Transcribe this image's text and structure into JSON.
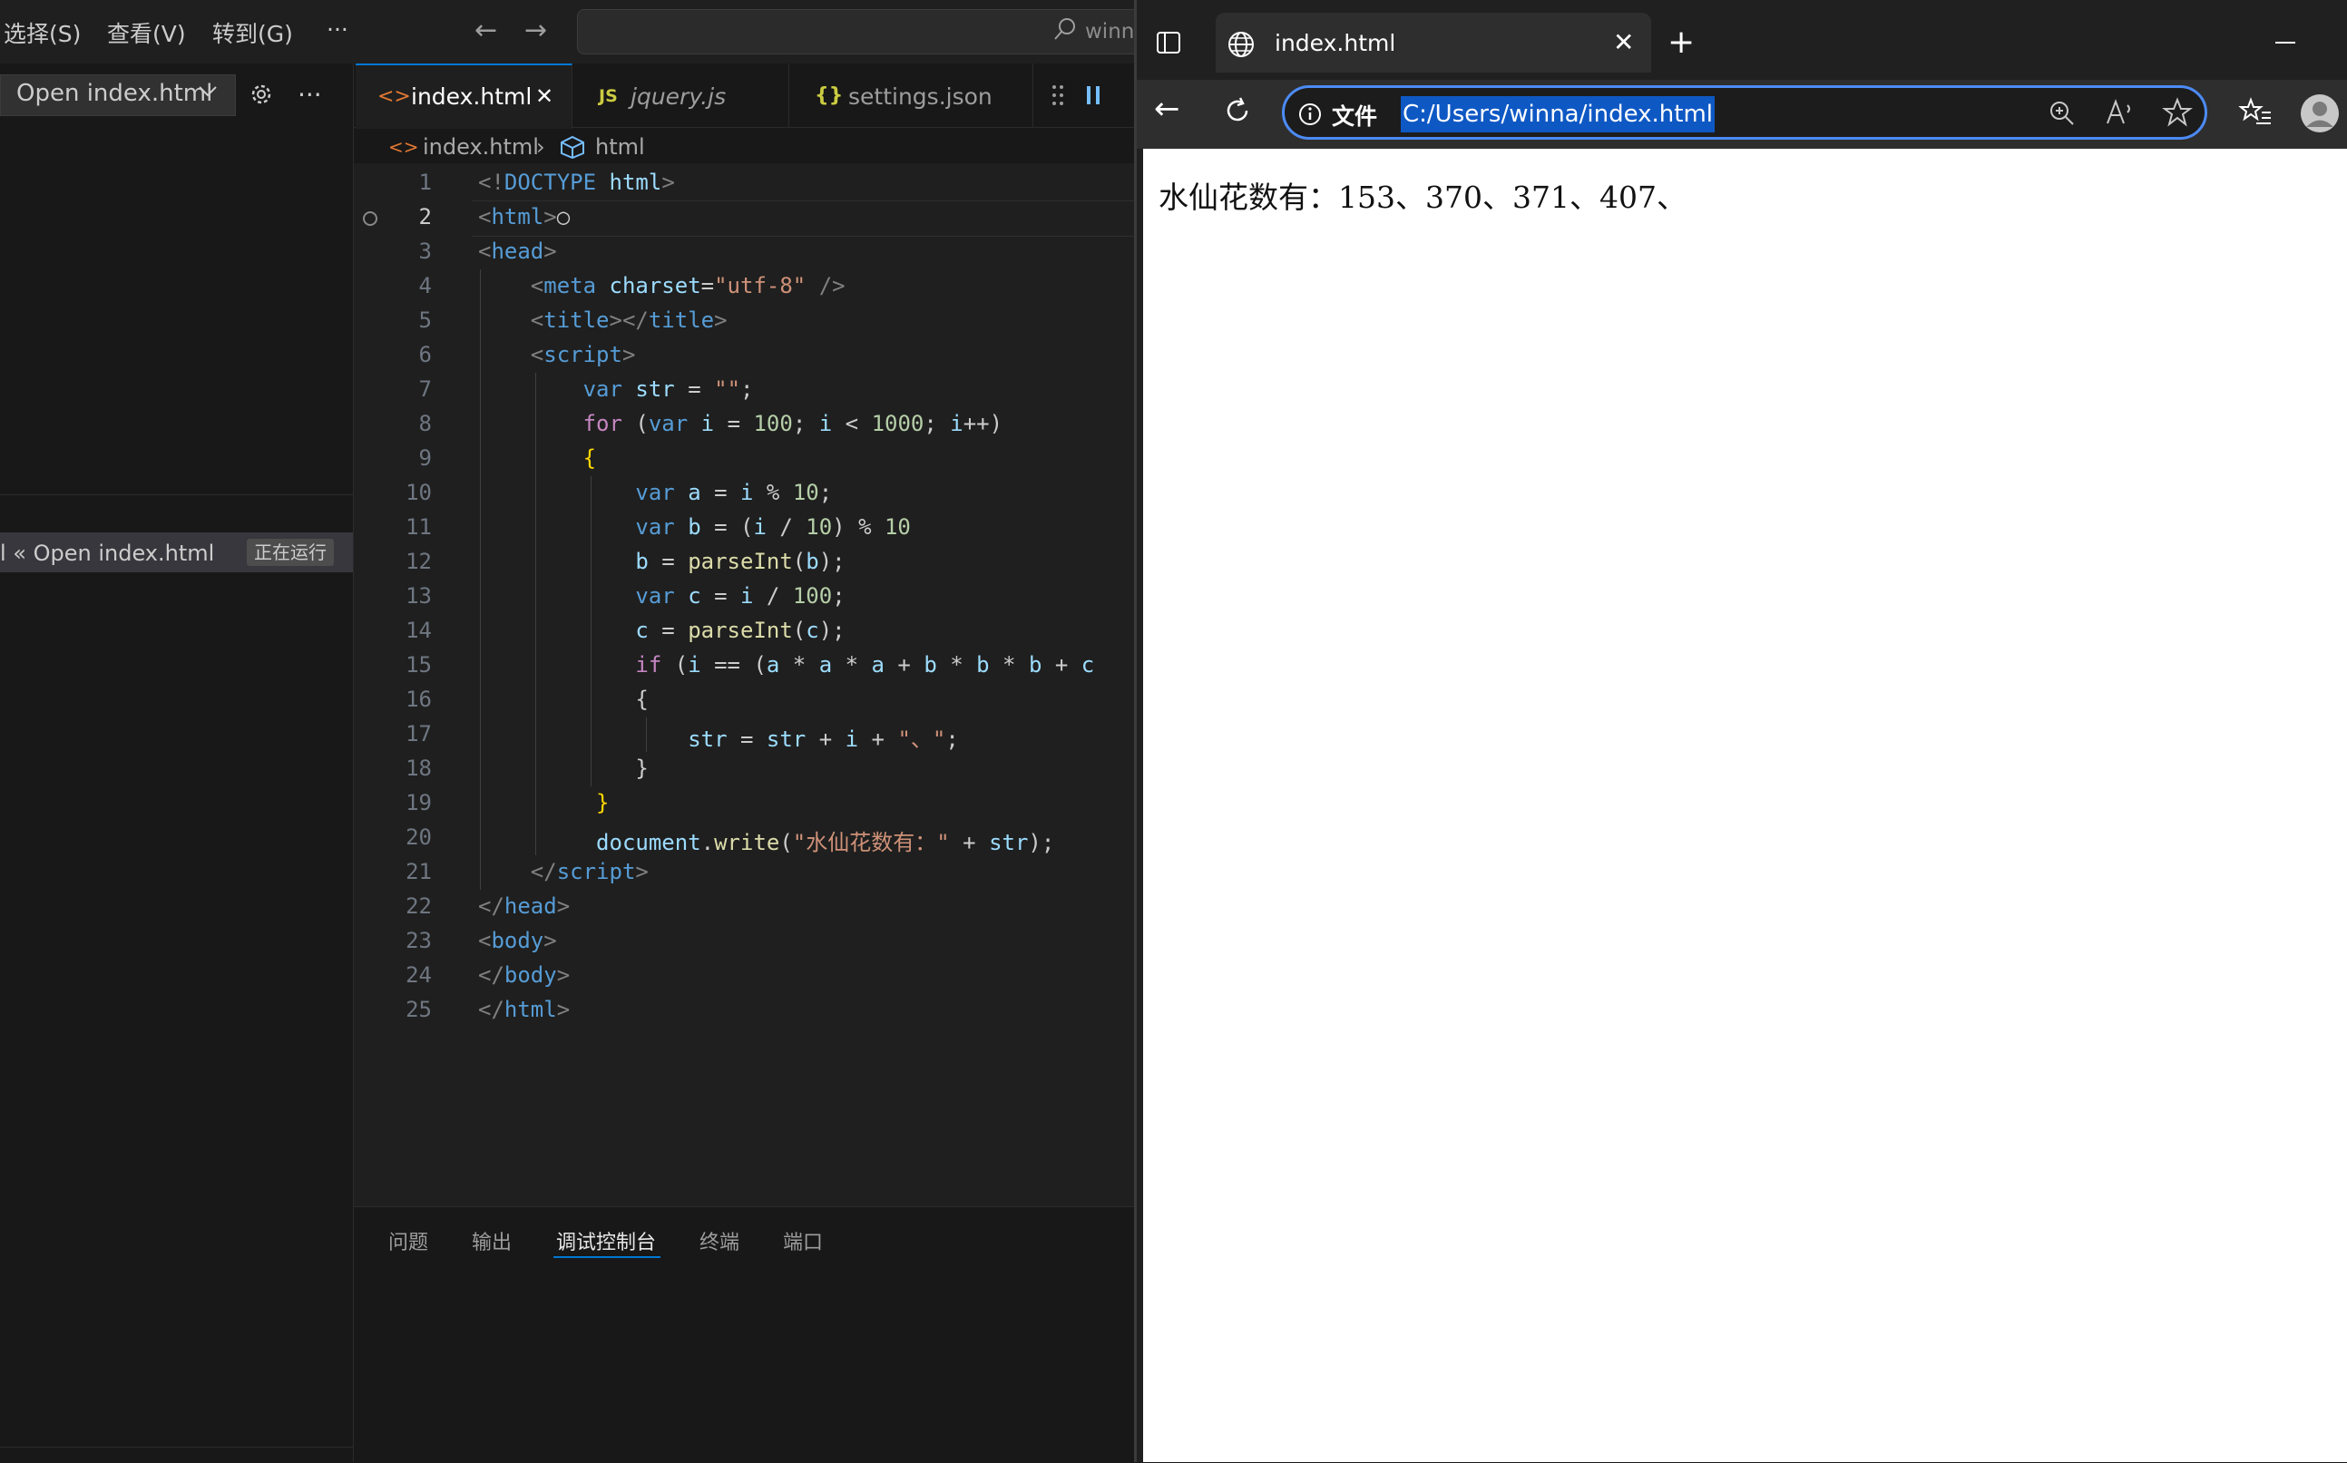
{
  "vscode": {
    "menu": [
      "选择(S)",
      "查看(V)",
      "转到(G)",
      "···"
    ],
    "command_center_text": "winn",
    "run_config": "Open index.html",
    "more_label": "···",
    "call_stack": {
      "label": "l « Open index.html",
      "status": "正在运行"
    },
    "tabs": [
      {
        "icon": "<>",
        "label": "index.html",
        "close": "✕",
        "active": true
      },
      {
        "icon": "JS",
        "label": "jquery.js",
        "active": false
      },
      {
        "icon": "{}",
        "label": "settings.json",
        "active": false
      }
    ],
    "breadcrumb": {
      "file": "index.html",
      "sep": "›",
      "symbol": "html"
    },
    "current_line": 2,
    "code_lines": [
      "1",
      "2",
      "3",
      "4",
      "5",
      "6",
      "7",
      "8",
      "9",
      "10",
      "11",
      "12",
      "13",
      "14",
      "15",
      "16",
      "17",
      "18",
      "19",
      "20",
      "21",
      "22",
      "23",
      "24",
      "25"
    ],
    "panel_tabs": [
      "问题",
      "输出",
      "调试控制台",
      "终端",
      "端口"
    ],
    "active_panel_tab": "调试控制台"
  },
  "browser": {
    "tab_title": "index.html",
    "tab_close": "✕",
    "new_tab": "+",
    "address_prefix": "文件",
    "url": "C:/Users/winna/index.html",
    "page_text": "水仙花数有：153、370、371、407、"
  },
  "colors": {
    "accent": "#0078d4",
    "keyword": "#569cd6",
    "control": "#c586c0",
    "variable": "#9cdcfe",
    "string": "#ce9178",
    "number": "#b5cea8",
    "function": "#dcdcaa",
    "tag": "#569cd6",
    "bracket": "#808080"
  }
}
